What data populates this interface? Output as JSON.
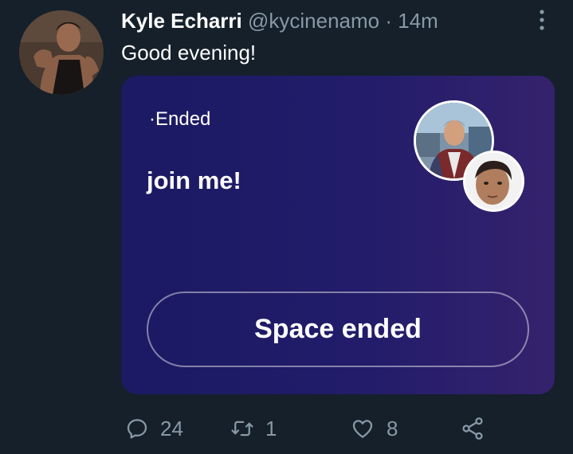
{
  "tweet": {
    "display_name": "Kyle Echarri",
    "handle": "@kycinenamo",
    "separator": "·",
    "time": "14m",
    "text": "Good evening!"
  },
  "space": {
    "status_dot": "·",
    "status": "Ended",
    "title": "join me!",
    "button_label": "Space ended",
    "colors": {
      "gradient_start": "#1b1a63",
      "gradient_end": "#35226d"
    }
  },
  "actions": {
    "reply_count": "24",
    "retweet_count": "1",
    "like_count": "8"
  },
  "icons": {
    "more": "more-vertical-icon",
    "reply": "reply-icon",
    "retweet": "retweet-icon",
    "like": "heart-icon",
    "share": "share-icon"
  },
  "colors": {
    "background": "#15202b",
    "secondary_text": "#8899a6"
  }
}
